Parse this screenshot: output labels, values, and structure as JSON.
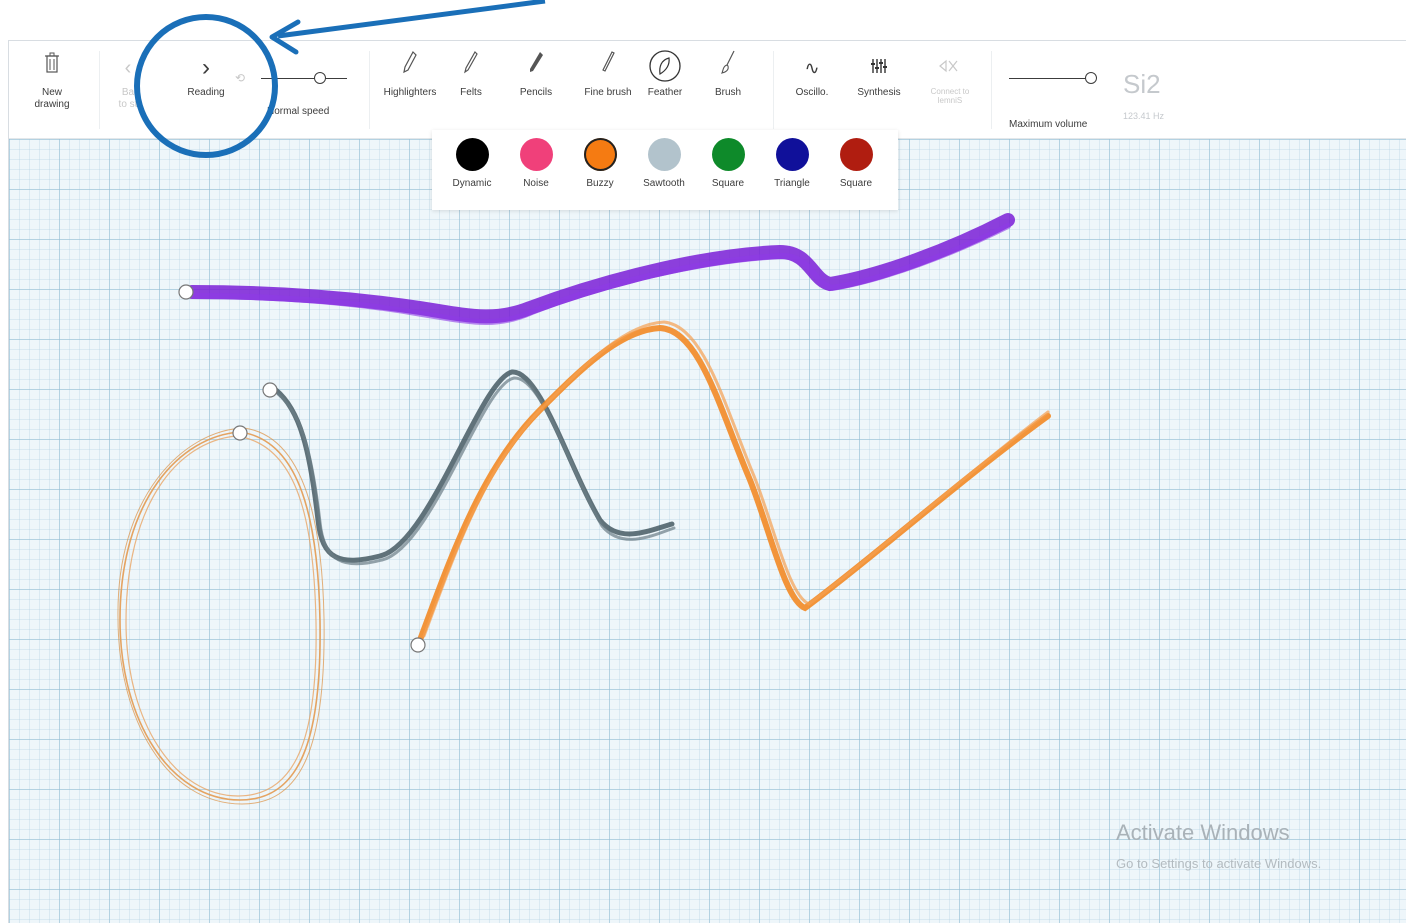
{
  "toolbar": {
    "new_drawing": "New\ndrawing",
    "back_to_start": "Ba\nto st",
    "reading": "Reading",
    "speed_label": "Normal speed",
    "tools": [
      "Highlighters",
      "Felts",
      "Pencils",
      "Fine brush",
      "Feather",
      "Brush"
    ],
    "selected_tool": "Feather",
    "oscillo": "Oscillo.",
    "synthesis": "Synthesis",
    "connect": "Connect to\nlemniS",
    "volume_label": "Maximum volume",
    "note": "Si2",
    "frequency": "123.41 Hz"
  },
  "palette": {
    "items": [
      {
        "name": "Dynamic",
        "color": "#000000"
      },
      {
        "name": "Noise",
        "color": "#f0407a"
      },
      {
        "name": "Buzzy",
        "color": "#f57b12"
      },
      {
        "name": "Sawtooth",
        "color": "#b2c3cc"
      },
      {
        "name": "Square",
        "color": "#0e8a2a"
      },
      {
        "name": "Triangle",
        "color": "#10109a"
      },
      {
        "name": "Square",
        "color": "#b01d10"
      }
    ],
    "selected": "Buzzy"
  },
  "strokes": [
    {
      "color": "#7a1fd6",
      "description": "purple"
    },
    {
      "color": "#475a63",
      "description": "dark gray"
    },
    {
      "color": "#f28a25",
      "description": "orange"
    },
    {
      "color": "#e39a50",
      "description": "light orange"
    }
  ],
  "watermark": {
    "title": "Activate Windows",
    "subtitle": "Go to Settings to activate Windows."
  },
  "annotation": {
    "color": "#1a6fb8"
  }
}
